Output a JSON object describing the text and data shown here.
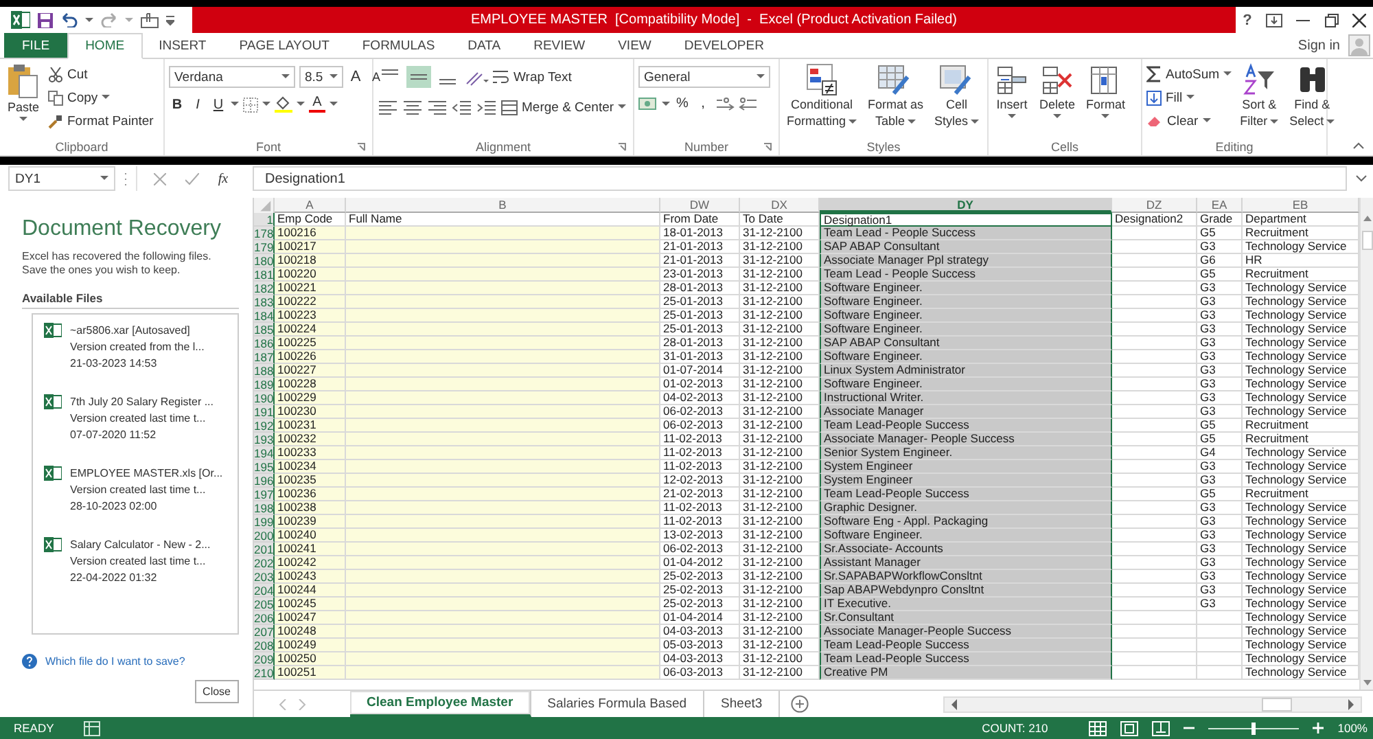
{
  "window": {
    "title": "EMPLOYEE MASTER  [Compatibility Mode]  -  Excel (Product Activation Failed)",
    "help": "?"
  },
  "menu_tabs": [
    {
      "label": "FILE",
      "kind": "file",
      "selected": false
    },
    {
      "label": "HOME",
      "kind": "tab",
      "selected": true
    },
    {
      "label": "INSERT",
      "kind": "tab",
      "selected": false
    },
    {
      "label": "PAGE LAYOUT",
      "kind": "tab",
      "selected": false
    },
    {
      "label": "FORMULAS",
      "kind": "tab",
      "selected": false
    },
    {
      "label": "DATA",
      "kind": "tab",
      "selected": false
    },
    {
      "label": "REVIEW",
      "kind": "tab",
      "selected": false
    },
    {
      "label": "VIEW",
      "kind": "tab",
      "selected": false
    },
    {
      "label": "DEVELOPER",
      "kind": "tab",
      "selected": false
    }
  ],
  "sign_in": "Sign in",
  "ribbon": {
    "clipboard": {
      "paste": "Paste",
      "cut": "Cut",
      "copy": "Copy",
      "format_painter": "Format Painter",
      "label": "Clipboard"
    },
    "font": {
      "font_name": "Verdana",
      "font_size": "8.5",
      "grow": "A",
      "shrink": "A",
      "styles": [
        "B",
        "I",
        "U"
      ],
      "font_color": "A",
      "label": "Font"
    },
    "alignment": {
      "vertical_align": [
        {
          "selected": false
        },
        {
          "selected": true
        },
        {
          "selected": false
        }
      ],
      "wrap_text": "Wrap Text",
      "merge_center": "Merge & Center",
      "label": "Alignment"
    },
    "number": {
      "format": "General",
      "percent": "%",
      "comma": ",",
      "label": "Number"
    },
    "styles": {
      "buttons": [
        {
          "line1": "Conditional",
          "line2": "Formatting"
        },
        {
          "line1": "Format as",
          "line2": "Table"
        },
        {
          "line1": "Cell",
          "line2": "Styles"
        }
      ],
      "label": "Styles"
    },
    "cells": {
      "buttons": [
        "Insert",
        "Delete",
        "Format"
      ],
      "label": "Cells"
    },
    "editing": {
      "autosum": "AutoSum",
      "fill": "Fill",
      "clear": "Clear",
      "sort": {
        "line1": "Sort &",
        "line2": "Filter"
      },
      "find": {
        "line1": "Find &",
        "line2": "Select"
      },
      "label": "Editing"
    }
  },
  "formula_bar": {
    "name_box": "DY1",
    "fx": "fx",
    "value": "Designation1"
  },
  "recovery": {
    "title": "Document Recovery",
    "message": "Excel has recovered the following files. Save the ones you wish to keep.",
    "files_heading": "Available Files",
    "files": [
      {
        "name": "~ar5806.xar  [Autosaved]",
        "detail": "Version created from the l...",
        "date": "21-03-2023 14:53"
      },
      {
        "name": "7th July 20 Salary Register ...",
        "detail": "Version created last time t...",
        "date": "07-07-2020 11:52"
      },
      {
        "name": "EMPLOYEE MASTER.xls  [Or...",
        "detail": "Version created last time t...",
        "date": "28-10-2023 02:00"
      },
      {
        "name": "Salary Calculator - New - 2...",
        "detail": "Version created last time t...",
        "date": "22-04-2022 01:32"
      }
    ],
    "help_link": "Which file do I want to save?",
    "close": "Close"
  },
  "sheet": {
    "columns": [
      {
        "letter": "A",
        "selected": false
      },
      {
        "letter": "B",
        "selected": false
      },
      {
        "letter": "DW",
        "selected": false
      },
      {
        "letter": "DX",
        "selected": false
      },
      {
        "letter": "DY",
        "selected": true
      },
      {
        "letter": "DZ",
        "selected": false
      },
      {
        "letter": "EA",
        "selected": false
      },
      {
        "letter": "EB",
        "selected": false
      }
    ],
    "header_row": {
      "row": "1",
      "cells": [
        "Emp Code",
        "Full Name",
        "From Date",
        "To Date",
        "Designation1",
        "Designation2",
        "Grade",
        "Department"
      ]
    },
    "rows": [
      {
        "row": "178",
        "emp_code": "100216",
        "from_date": "18-01-2013",
        "to_date": "31-12-2100",
        "designation1": "Team Lead - People Success",
        "grade": "G5",
        "department": "Recruitment"
      },
      {
        "row": "179",
        "emp_code": "100217",
        "from_date": "21-01-2013",
        "to_date": "31-12-2100",
        "designation1": "SAP ABAP Consultant",
        "grade": "G3",
        "department": "Technology Service"
      },
      {
        "row": "180",
        "emp_code": "100218",
        "from_date": "21-01-2013",
        "to_date": "31-12-2100",
        "designation1": "Associate Manager Ppl strategy",
        "grade": "G6",
        "department": "HR"
      },
      {
        "row": "181",
        "emp_code": "100220",
        "from_date": "23-01-2013",
        "to_date": "31-12-2100",
        "designation1": "Team Lead - People Success",
        "grade": "G5",
        "department": "Recruitment"
      },
      {
        "row": "182",
        "emp_code": "100221",
        "from_date": "28-01-2013",
        "to_date": "31-12-2100",
        "designation1": "Software Engineer.",
        "grade": "G3",
        "department": "Technology Service"
      },
      {
        "row": "183",
        "emp_code": "100222",
        "from_date": "25-01-2013",
        "to_date": "31-12-2100",
        "designation1": "Software Engineer.",
        "grade": "G3",
        "department": "Technology Service"
      },
      {
        "row": "184",
        "emp_code": "100223",
        "from_date": "25-01-2013",
        "to_date": "31-12-2100",
        "designation1": "Software Engineer.",
        "grade": "G3",
        "department": "Technology Service"
      },
      {
        "row": "185",
        "emp_code": "100224",
        "from_date": "25-01-2013",
        "to_date": "31-12-2100",
        "designation1": "Software Engineer.",
        "grade": "G3",
        "department": "Technology Service"
      },
      {
        "row": "186",
        "emp_code": "100225",
        "from_date": "28-01-2013",
        "to_date": "31-12-2100",
        "designation1": "SAP ABAP Consultant",
        "grade": "G3",
        "department": "Technology Service"
      },
      {
        "row": "187",
        "emp_code": "100226",
        "from_date": "31-01-2013",
        "to_date": "31-12-2100",
        "designation1": "Software Engineer.",
        "grade": "G3",
        "department": "Technology Service"
      },
      {
        "row": "188",
        "emp_code": "100227",
        "from_date": "01-07-2014",
        "to_date": "31-12-2100",
        "designation1": "Linux System Administrator",
        "grade": "G3",
        "department": "Technology Service"
      },
      {
        "row": "189",
        "emp_code": "100228",
        "from_date": "01-02-2013",
        "to_date": "31-12-2100",
        "designation1": "Software Engineer.",
        "grade": "G3",
        "department": "Technology Service"
      },
      {
        "row": "190",
        "emp_code": "100229",
        "from_date": "04-02-2013",
        "to_date": "31-12-2100",
        "designation1": "Instructional Writer.",
        "grade": "G3",
        "department": "Technology Service"
      },
      {
        "row": "191",
        "emp_code": "100230",
        "from_date": "06-02-2013",
        "to_date": "31-12-2100",
        "designation1": "Associate Manager",
        "grade": "G3",
        "department": "Technology Service"
      },
      {
        "row": "192",
        "emp_code": "100231",
        "from_date": "06-02-2013",
        "to_date": "31-12-2100",
        "designation1": "Team Lead-People Success",
        "grade": "G5",
        "department": "Recruitment"
      },
      {
        "row": "193",
        "emp_code": "100232",
        "from_date": "11-02-2013",
        "to_date": "31-12-2100",
        "designation1": "Associate Manager- People Success",
        "grade": "G5",
        "department": "Recruitment"
      },
      {
        "row": "194",
        "emp_code": "100233",
        "from_date": "11-02-2013",
        "to_date": "31-12-2100",
        "designation1": "Senior System Engineer.",
        "grade": "G4",
        "department": "Technology Service"
      },
      {
        "row": "195",
        "emp_code": "100234",
        "from_date": "11-02-2013",
        "to_date": "31-12-2100",
        "designation1": "System Engineer",
        "grade": "G3",
        "department": "Technology Service"
      },
      {
        "row": "196",
        "emp_code": "100235",
        "from_date": "12-02-2013",
        "to_date": "31-12-2100",
        "designation1": "System Engineer",
        "grade": "G3",
        "department": "Technology Service"
      },
      {
        "row": "197",
        "emp_code": "100236",
        "from_date": "21-02-2013",
        "to_date": "31-12-2100",
        "designation1": "Team Lead-People Success",
        "grade": "G5",
        "department": "Recruitment"
      },
      {
        "row": "198",
        "emp_code": "100238",
        "from_date": "11-02-2013",
        "to_date": "31-12-2100",
        "designation1": "Graphic Designer.",
        "grade": "G3",
        "department": "Technology Service"
      },
      {
        "row": "199",
        "emp_code": "100239",
        "from_date": "11-02-2013",
        "to_date": "31-12-2100",
        "designation1": "Software Eng - Appl. Packaging",
        "grade": "G3",
        "department": "Technology Service"
      },
      {
        "row": "200",
        "emp_code": "100240",
        "from_date": "13-02-2013",
        "to_date": "31-12-2100",
        "designation1": "Software Engineer.",
        "grade": "G3",
        "department": "Technology Service"
      },
      {
        "row": "201",
        "emp_code": "100241",
        "from_date": "06-02-2013",
        "to_date": "31-12-2100",
        "designation1": "Sr.Associate- Accounts",
        "grade": "G3",
        "department": "Technology Service"
      },
      {
        "row": "202",
        "emp_code": "100242",
        "from_date": "01-04-2012",
        "to_date": "31-12-2100",
        "designation1": "Assistant Manager",
        "grade": "G3",
        "department": "Technology Service"
      },
      {
        "row": "203",
        "emp_code": "100243",
        "from_date": "25-02-2013",
        "to_date": "31-12-2100",
        "designation1": "Sr.SAPABAPWorkflowConsltnt",
        "grade": "G3",
        "department": "Technology Service"
      },
      {
        "row": "204",
        "emp_code": "100244",
        "from_date": "25-02-2013",
        "to_date": "31-12-2100",
        "designation1": "Sap ABAPWebdynpro Consltnt",
        "grade": "G3",
        "department": "Technology Service"
      },
      {
        "row": "205",
        "emp_code": "100245",
        "from_date": "25-02-2013",
        "to_date": "31-12-2100",
        "designation1": "IT Executive.",
        "grade": "G3",
        "department": "Technology Service"
      },
      {
        "row": "206",
        "emp_code": "100247",
        "from_date": "01-04-2014",
        "to_date": "31-12-2100",
        "designation1": "Sr.Consultant",
        "department": "Technology Service"
      },
      {
        "row": "207",
        "emp_code": "100248",
        "from_date": "04-03-2013",
        "to_date": "31-12-2100",
        "designation1": "Associate Manager-People Success",
        "department": "Technology Service"
      },
      {
        "row": "208",
        "emp_code": "100249",
        "from_date": "05-03-2013",
        "to_date": "31-12-2100",
        "designation1": "Team Lead-People Success",
        "department": "Technology Service"
      },
      {
        "row": "209",
        "emp_code": "100250",
        "from_date": "04-03-2013",
        "to_date": "31-12-2100",
        "designation1": "Team Lead-People Success",
        "department": "Technology Service"
      },
      {
        "row": "210",
        "emp_code": "100251",
        "from_date": "06-03-2013",
        "to_date": "31-12-2100",
        "designation1": "Creative PM",
        "department": "Technology Service"
      }
    ]
  },
  "sheet_tabs": [
    {
      "label": "Clean Employee Master",
      "selected": true
    },
    {
      "label": "Salaries Formula Based",
      "selected": false
    },
    {
      "label": "Sheet3",
      "selected": false
    }
  ],
  "status_bar": {
    "mode": "READY",
    "count": "COUNT: 210",
    "zoom": "100%",
    "zoom_slider": {
      "level": 0.5
    }
  }
}
